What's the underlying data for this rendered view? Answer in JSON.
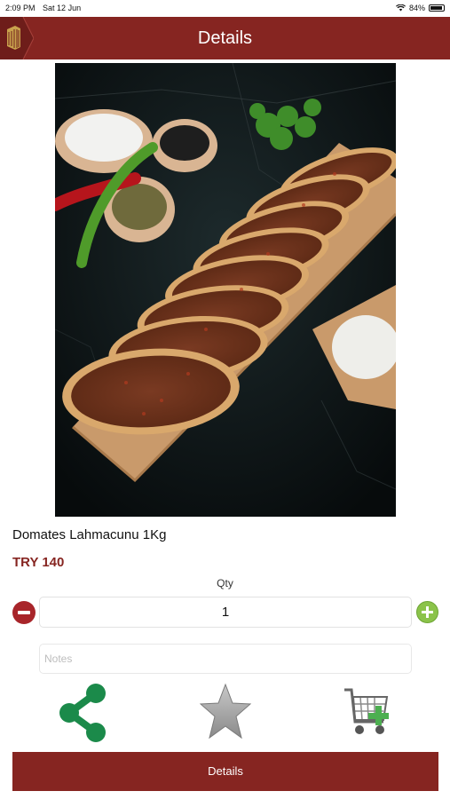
{
  "status_bar": {
    "time": "2:09 PM",
    "date": "Sat 12 Jun",
    "battery": "84%"
  },
  "nav": {
    "title": "Details",
    "logo_icon": "store-logo-icon"
  },
  "product": {
    "name": "Domates Lahmacunu 1Kg",
    "price": "TRY 140"
  },
  "quantity": {
    "label": "Qty",
    "value": "1"
  },
  "notes": {
    "placeholder": "Notes",
    "value": ""
  },
  "actions": {
    "share_icon": "share-icon",
    "favorite_icon": "star-icon",
    "cart_icon": "add-to-cart-icon"
  },
  "bottom_button": {
    "label": "Details"
  },
  "colors": {
    "brand": "#862521",
    "minus": "#a8252a",
    "plus": "#8bc34a",
    "share": "#1b8a4a",
    "star": "#9e9e9e"
  }
}
